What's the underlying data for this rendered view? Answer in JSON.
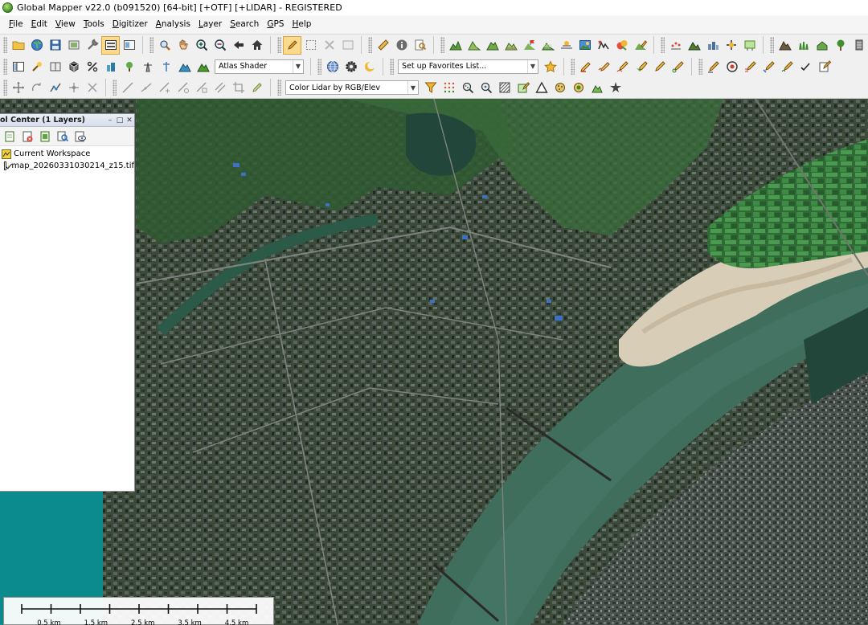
{
  "window": {
    "title": "Global Mapper v22.0 (b091520) [64-bit] [+OTF] [+LIDAR] - REGISTERED"
  },
  "menu": [
    "File",
    "Edit",
    "View",
    "Tools",
    "Digitizer",
    "Analysis",
    "Layer",
    "Search",
    "GPS",
    "Help"
  ],
  "toolbar": {
    "shader_combo": "Atlas Shader",
    "favorites_combo": "Set up Favorites List...",
    "lidar_combo": "Color Lidar by RGB/Elev"
  },
  "control_center": {
    "title": "ol Center (1 Layers)",
    "minimize": "–",
    "restore": "□",
    "close": "✕",
    "workspace_label": "Current Workspace",
    "layers": [
      {
        "name": "map_20260331030214_z15.tif",
        "checked": true
      }
    ]
  },
  "scalebar": {
    "labels": [
      "0.5 km",
      "1.5 km",
      "2.5 km",
      "3.5 km",
      "4.5 km"
    ]
  },
  "colors": {
    "accent_active": "#fbd98f",
    "teal_background": "#0c8b8c",
    "river": "#3f6e5d",
    "sandbar": "#d8cdb7"
  }
}
